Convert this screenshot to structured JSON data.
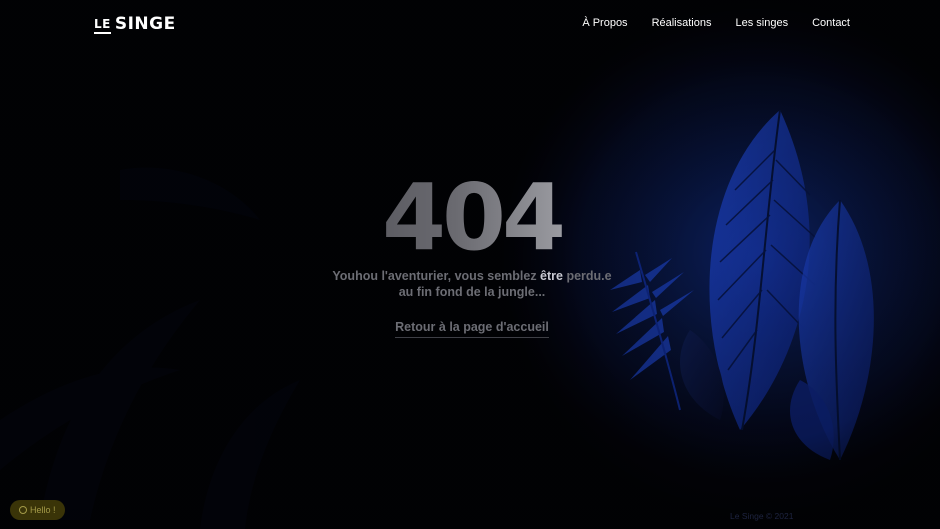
{
  "header": {
    "logo_small": "LE",
    "logo_main": "SINGE",
    "nav": [
      {
        "label": "À Propos"
      },
      {
        "label": "Réalisations"
      },
      {
        "label": "Les singes"
      },
      {
        "label": "Contact"
      }
    ]
  },
  "error": {
    "code": "404",
    "message_part1": "Youhou l'aventurier, vous semblez ",
    "message_highlight": "être",
    "message_part2": " perdu.e au fin fond de la jungle...",
    "home_link": "Retour à la page d'accueil"
  },
  "chat_widget": {
    "label": "Hello !"
  },
  "footer": {
    "copyright": "Le Singe © 2021"
  },
  "colors": {
    "background": "#04050c",
    "foliage_glow": "#0b2d9a",
    "text_muted": "#6c6d74",
    "text_highlight": "#c9c9d2",
    "chat_widget_bg": "#3a3408"
  }
}
